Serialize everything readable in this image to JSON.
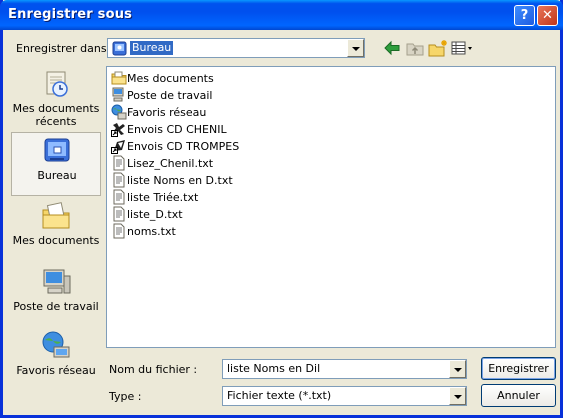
{
  "window": {
    "title": "Enregistrer sous",
    "help_glyph": "?",
    "close_glyph": "✕"
  },
  "location": {
    "label": "Enregistrer dans :",
    "value": "Bureau"
  },
  "places": [
    {
      "label": "Mes documents récents",
      "icon": "recent-documents-icon"
    },
    {
      "label": "Bureau",
      "icon": "desktop-icon"
    },
    {
      "label": "Mes documents",
      "icon": "my-documents-icon"
    },
    {
      "label": "Poste de travail",
      "icon": "my-computer-icon"
    },
    {
      "label": "Favoris réseau",
      "icon": "network-places-icon"
    }
  ],
  "files": [
    {
      "name": "Mes documents",
      "icon": "folder-icon"
    },
    {
      "name": "Poste de travail",
      "icon": "computer-icon"
    },
    {
      "name": "Favoris réseau",
      "icon": "network-icon"
    },
    {
      "name": "Envois CD CHENIL",
      "icon": "shortcut-icon"
    },
    {
      "name": "Envois CD TROMPES",
      "icon": "shortcut-icon"
    },
    {
      "name": "Lisez_Chenil.txt",
      "icon": "text-file-icon"
    },
    {
      "name": "liste Noms en D.txt",
      "icon": "text-file-icon"
    },
    {
      "name": "liste Triée.txt",
      "icon": "text-file-icon"
    },
    {
      "name": "liste_D.txt",
      "icon": "text-file-icon"
    },
    {
      "name": "noms.txt",
      "icon": "text-file-icon"
    }
  ],
  "filename": {
    "label": "Nom du fichier :",
    "value": "liste Noms en Dil"
  },
  "filetype": {
    "label": "Type :",
    "value": "Fichier texte (*.txt)"
  },
  "buttons": {
    "save": "Enregistrer",
    "cancel": "Annuler"
  }
}
